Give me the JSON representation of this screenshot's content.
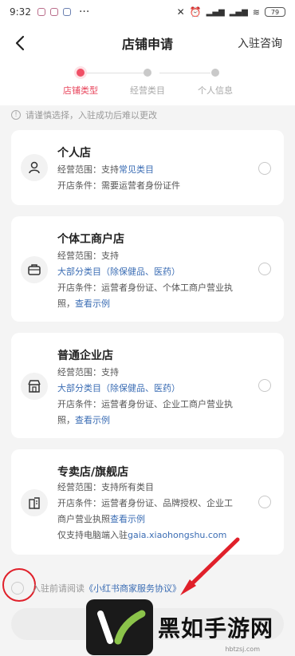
{
  "status_bar": {
    "time": "9:32",
    "battery": "79"
  },
  "nav": {
    "title": "店铺申请",
    "right_link": "入驻咨询"
  },
  "steps": [
    {
      "label": "店铺类型",
      "active": true
    },
    {
      "label": "经营类目",
      "active": false
    },
    {
      "label": "个人信息",
      "active": false
    }
  ],
  "notice": "请谨慎选择，入驻成功后难以更改",
  "cards": [
    {
      "title": "个人店",
      "icon": "person-icon",
      "scope_prefix": "经营范围：支持",
      "scope_highlight": "常见类目",
      "scope_rest": "",
      "cond_prefix": "开店条件：需要运营者身份证件",
      "cond_link": "",
      "extra_prefix": "",
      "extra_link": ""
    },
    {
      "title": "个体工商户店",
      "icon": "briefcase-icon",
      "scope_prefix": "经营范围：支持",
      "scope_highlight": "大部分类目（除保健品、医药）",
      "scope_rest": "",
      "cond_prefix": "开店条件：运营者身份证、个体工商户营业执照，",
      "cond_link": "查看示例",
      "extra_prefix": "",
      "extra_link": ""
    },
    {
      "title": "普通企业店",
      "icon": "store-icon",
      "scope_prefix": "经营范围：支持",
      "scope_highlight": "大部分类目（除保健品、医药）",
      "scope_rest": "",
      "cond_prefix": "开店条件：运营者身份证、企业工商户营业执照，",
      "cond_link": "查看示例",
      "extra_prefix": "",
      "extra_link": ""
    },
    {
      "title": "专卖店/旗舰店",
      "icon": "building-icon",
      "scope_prefix": "经营范围：支持所有类目",
      "scope_highlight": "",
      "scope_rest": "",
      "cond_prefix": "开店条件：运营者身份证、品牌授权、企业工商户营业执照",
      "cond_link": "查看示例",
      "extra_prefix": "仅支持电脑端入驻",
      "extra_link": "gaia.xiaohongshu.com"
    }
  ],
  "agreement": {
    "prefix": "入驻前请阅读",
    "link": "《小红书商家服务协议》"
  },
  "watermark": {
    "text": "黑如手游网",
    "sub": "hbtzsj.com"
  },
  "colors": {
    "accent": "#f05066",
    "link": "#3b6db4",
    "annotation": "#e0202a"
  }
}
